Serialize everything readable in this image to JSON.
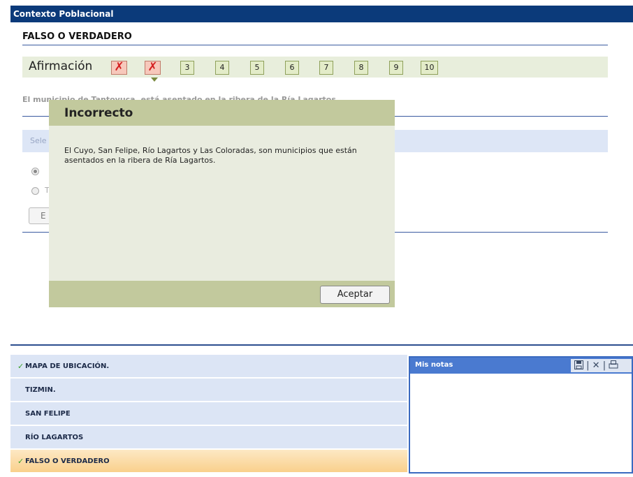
{
  "window": {
    "title": "Contexto Poblacional"
  },
  "section": {
    "heading": "FALSO O VERDADERO"
  },
  "afirmacion": {
    "label": "Afirmación",
    "buttons": [
      "✗",
      "✗",
      "3",
      "4",
      "5",
      "6",
      "7",
      "8",
      "9",
      "10"
    ]
  },
  "question": {
    "text": "El municipio de Tantoyuca, está asentado en la ribera de la Ría Lagartos."
  },
  "answer": {
    "select_prompt": "Sele",
    "options": [
      "",
      "T"
    ],
    "send_label": "E"
  },
  "modal": {
    "title": "Incorrecto",
    "message": "El Cuyo, San Felipe, Río Lagartos y Las Coloradas, son municipios que están asentados en la ribera de Ría Lagartos.",
    "accept_label": "Aceptar"
  },
  "nav": {
    "items": [
      {
        "label": "MAPA DE UBICACIÓN.",
        "check": "✓"
      },
      {
        "label": "TIZMIN.",
        "check": ""
      },
      {
        "label": "SAN FELIPE",
        "check": ""
      },
      {
        "label": "RÍO LAGARTOS",
        "check": ""
      },
      {
        "label": "FALSO O VERDADERO",
        "check": "✓"
      }
    ]
  },
  "notes": {
    "title": "Mis notas",
    "tools": [
      "save-icon",
      "close-icon",
      "print-icon"
    ],
    "tool_separator": "|",
    "close_glyph": "✕"
  }
}
